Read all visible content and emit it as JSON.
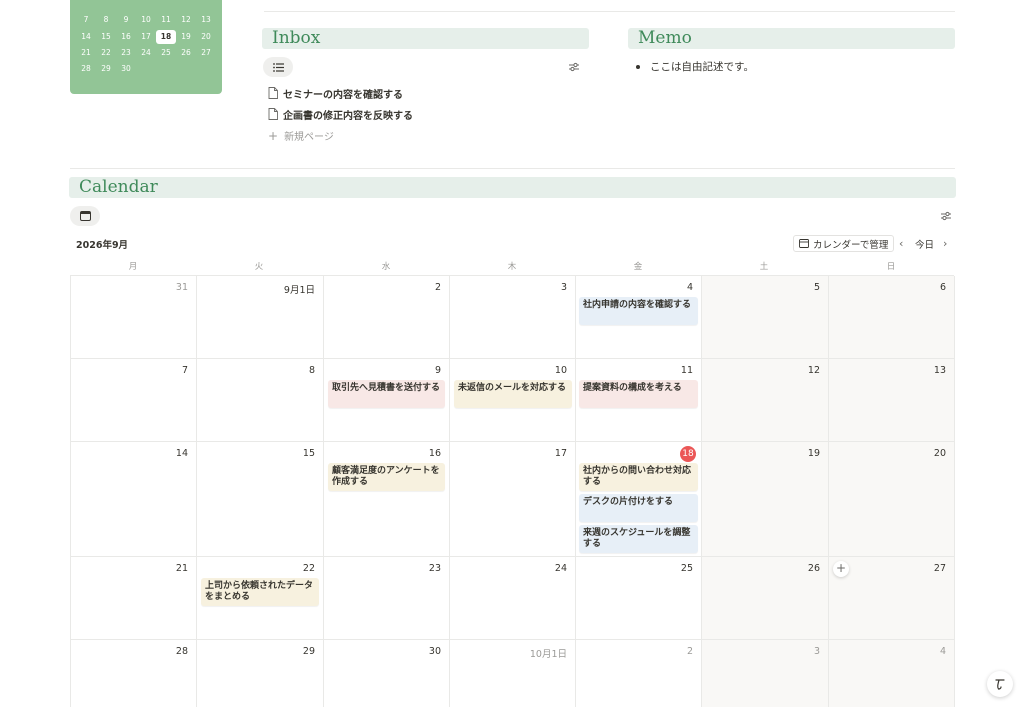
{
  "mini_calendar": {
    "rows": [
      [
        "7",
        "8",
        "9",
        "10",
        "11",
        "12",
        "13"
      ],
      [
        "14",
        "15",
        "16",
        "17",
        "18",
        "19",
        "20"
      ],
      [
        "21",
        "22",
        "23",
        "24",
        "25",
        "26",
        "27"
      ],
      [
        "28",
        "29",
        "30",
        "",
        "",
        "",
        ""
      ]
    ],
    "today": "18"
  },
  "inbox": {
    "title": "Inbox",
    "items": [
      {
        "label": "セミナーの内容を確認する"
      },
      {
        "label": "企画書の修正内容を反映する"
      }
    ],
    "new_page": "新規ページ"
  },
  "memo": {
    "title": "Memo",
    "bullet": "ここは自由記述です。"
  },
  "calendar": {
    "title": "Calendar",
    "month": "2026年9月",
    "manage_label": "カレンダーで管理",
    "today_label": "今日",
    "weekdays": [
      "月",
      "火",
      "水",
      "木",
      "金",
      "土",
      "日"
    ],
    "weeks": [
      [
        "31",
        "9月1日",
        "2",
        "3",
        "4",
        "5",
        "6"
      ],
      [
        "7",
        "8",
        "9",
        "10",
        "11",
        "12",
        "13"
      ],
      [
        "14",
        "15",
        "16",
        "17",
        "18",
        "19",
        "20"
      ],
      [
        "21",
        "22",
        "23",
        "24",
        "25",
        "26",
        "27"
      ],
      [
        "28",
        "29",
        "30",
        "10月1日",
        "2",
        "3",
        "4"
      ]
    ],
    "events": [
      {
        "label": "社内申請の内容を確認する",
        "color": "#e7eff7"
      },
      {
        "label": "取引先へ見積書を送付する",
        "color": "#f8e8e6"
      },
      {
        "label": "未返信のメールを対応する",
        "color": "#f7f1df"
      },
      {
        "label": "提案資料の構成を考える",
        "color": "#f8e8e6"
      },
      {
        "label": "顧客満足度のアンケートを作成する",
        "color": "#f7f1df"
      },
      {
        "label": "社内からの問い合わせ対応する",
        "color": "#f7f1df"
      },
      {
        "label": "デスクの片付けをする",
        "color": "#e7eff7"
      },
      {
        "label": "来週のスケジュールを調整する",
        "color": "#e7eff7"
      },
      {
        "label": "上司から依頼されたデータをまとめる",
        "color": "#f7f1df"
      }
    ]
  },
  "colors": {
    "accent_green": "#3f8a5a",
    "mini_calendar_bg": "#92c596",
    "section_header_bg": "#e6efea",
    "today_red": "#eb5757"
  }
}
